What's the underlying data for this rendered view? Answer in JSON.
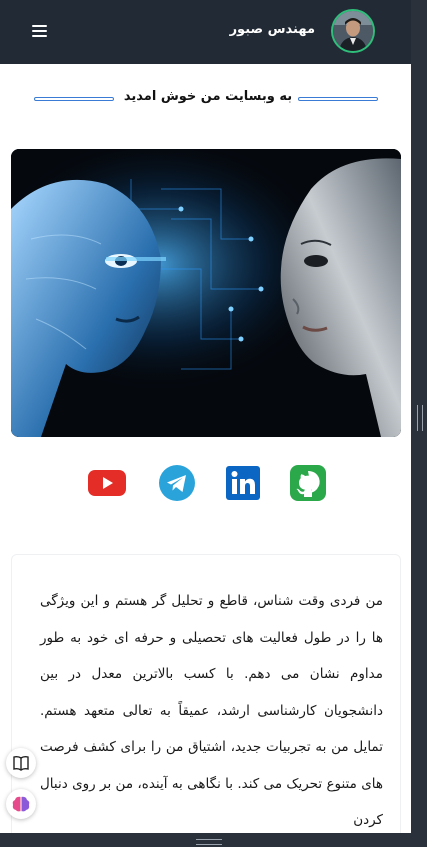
{
  "header": {
    "site_name": "مهندس صبور",
    "menu_icon": "hamburger-menu-icon",
    "avatar_icon": "profile-photo"
  },
  "welcome": {
    "title": "به وبسایت من خوش امدید"
  },
  "hero": {
    "description_icon": "ai-faces-illustration"
  },
  "socials": [
    {
      "name": "youtube-icon",
      "color": "#e52d27"
    },
    {
      "name": "telegram-icon",
      "color": "#2aa3db"
    },
    {
      "name": "linkedin-icon",
      "color": "#0a66c2"
    },
    {
      "name": "github-icon",
      "color": "#2ba84a"
    }
  ],
  "bio": {
    "text": "من فردی وقت شناس، قاطع و تحلیل گر هستم و این ویژگی ها را در طول فعالیت های تحصیلی و حرفه ای خود به طور مداوم نشان می دهم. با کسب بالاترین معدل در بین دانشجویان کارشناسی ارشد، عمیقاً به تعالی متعهد هستم. تمایل من به تجربیات جدید، اشتیاق من را برای کشف فرصت های متنوع تحریک می کند. با نگاهی به آینده، من بر روی دنبال کردن"
  },
  "floating": [
    {
      "name": "book-icon"
    },
    {
      "name": "brain-icon"
    }
  ],
  "colors": {
    "header_bg": "#222a36",
    "accent_line": "#3a7bd5",
    "avatar_ring": "#2fbf7a"
  }
}
